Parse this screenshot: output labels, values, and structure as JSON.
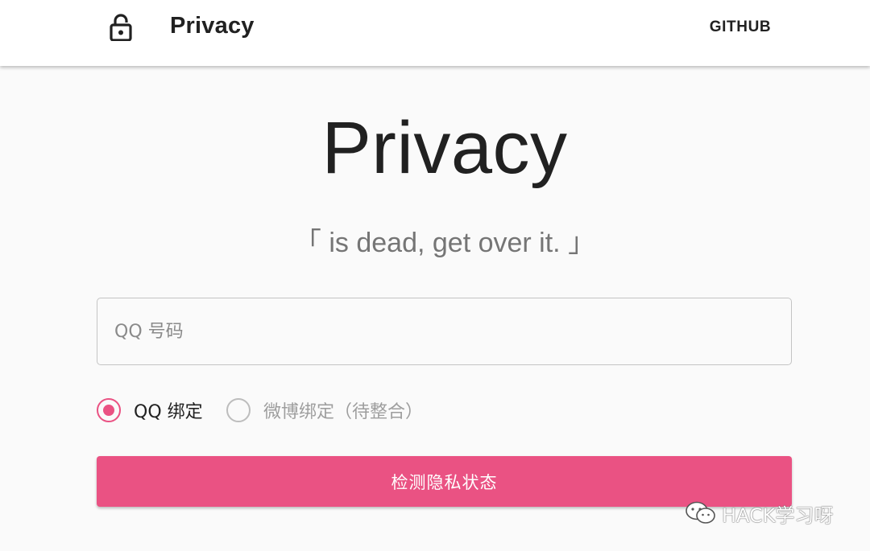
{
  "appbar": {
    "icon": "lock-open-icon",
    "title": "Privacy",
    "github_label": "GITHUB"
  },
  "hero": {
    "title": "Privacy",
    "subtitle": "「 is dead, get over it. 」"
  },
  "form": {
    "qq_input": {
      "value": "",
      "placeholder": "QQ 号码"
    },
    "radios": [
      {
        "label": "QQ 绑定",
        "checked": true
      },
      {
        "label": "微博绑定（待整合）",
        "checked": false
      }
    ],
    "submit_label": "检测隐私状态"
  },
  "watermark": {
    "icon": "wechat-icon",
    "text": "HACK学习呀"
  },
  "colors": {
    "accent": "#ea5283",
    "background": "#fafafa",
    "appbar": "#ffffff",
    "text_primary": "#212121",
    "text_secondary": "#757575"
  }
}
